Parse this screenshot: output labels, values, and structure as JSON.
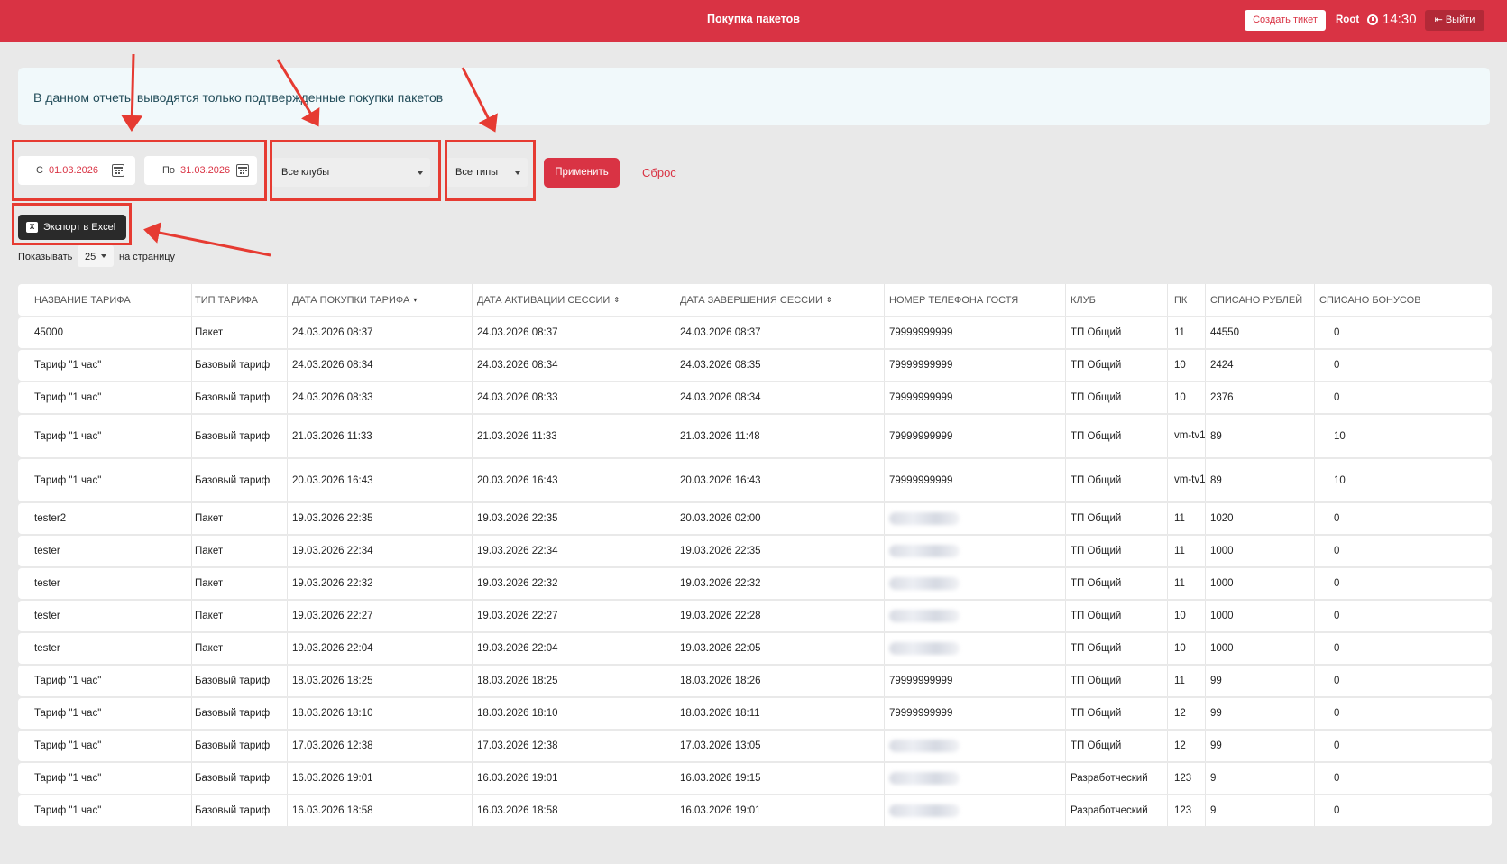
{
  "header": {
    "title": "Покупка пакетов",
    "create_ticket": "Создать тикет",
    "user": "Root",
    "time": "14:30",
    "logout": "Выйти"
  },
  "notice": "В данном отчеты выводятся только подтвержденные покупки пакетов",
  "filters": {
    "date_from_label": "С",
    "date_from": "01.03.2026",
    "date_to_label": "По",
    "date_to": "31.03.2026",
    "club_select": "Все клубы",
    "type_select": "Все типы",
    "apply": "Применить",
    "reset": "Сброс"
  },
  "export_button": "Экспорт в Excel",
  "pagination": {
    "show_label": "Показывать",
    "per_page": "25",
    "per_page_suffix": "на страницу"
  },
  "table": {
    "headers": [
      "НАЗВАНИЕ ТАРИФА",
      "ТИП ТАРИФА",
      "ДАТА ПОКУПКИ ТАРИФА",
      "ДАТА АКТИВАЦИИ СЕССИИ",
      "ДАТА ЗАВЕРШЕНИЯ СЕССИИ",
      "НОМЕР ТЕЛЕФОНА ГОСТЯ",
      "КЛУБ",
      "ПК",
      "СПИСАНО РУБЛЕЙ",
      "СПИСАНО БОНУСОВ"
    ],
    "rows": [
      [
        "45000",
        "Пакет",
        "24.03.2026 08:37",
        "24.03.2026 08:37",
        "24.03.2026 08:37",
        "79999999999",
        "ТП Общий",
        "11",
        "44550",
        "0"
      ],
      [
        "Тариф \"1 час\"",
        "Базовый тариф",
        "24.03.2026 08:34",
        "24.03.2026 08:34",
        "24.03.2026 08:35",
        "79999999999",
        "ТП Общий",
        "10",
        "2424",
        "0"
      ],
      [
        "Тариф \"1 час\"",
        "Базовый тариф",
        "24.03.2026 08:33",
        "24.03.2026 08:33",
        "24.03.2026 08:34",
        "79999999999",
        "ТП Общий",
        "10",
        "2376",
        "0"
      ],
      [
        "Тариф \"1 час\"",
        "Базовый тариф",
        "21.03.2026 11:33",
        "21.03.2026 11:33",
        "21.03.2026 11:48",
        "79999999999",
        "ТП Общий",
        "vm-tv1",
        "89",
        "10"
      ],
      [
        "Тариф \"1 час\"",
        "Базовый тариф",
        "20.03.2026 16:43",
        "20.03.2026 16:43",
        "20.03.2026 16:43",
        "79999999999",
        "ТП Общий",
        "vm-tv1",
        "89",
        "10"
      ],
      [
        "tester2",
        "Пакет",
        "19.03.2026 22:35",
        "19.03.2026 22:35",
        "20.03.2026 02:00",
        "",
        "ТП Общий",
        "11",
        "1020",
        "0"
      ],
      [
        "tester",
        "Пакет",
        "19.03.2026 22:34",
        "19.03.2026 22:34",
        "19.03.2026 22:35",
        "",
        "ТП Общий",
        "11",
        "1000",
        "0"
      ],
      [
        "tester",
        "Пакет",
        "19.03.2026 22:32",
        "19.03.2026 22:32",
        "19.03.2026 22:32",
        "",
        "ТП Общий",
        "11",
        "1000",
        "0"
      ],
      [
        "tester",
        "Пакет",
        "19.03.2026 22:27",
        "19.03.2026 22:27",
        "19.03.2026 22:28",
        "",
        "ТП Общий",
        "10",
        "1000",
        "0"
      ],
      [
        "tester",
        "Пакет",
        "19.03.2026 22:04",
        "19.03.2026 22:04",
        "19.03.2026 22:05",
        "",
        "ТП Общий",
        "10",
        "1000",
        "0"
      ],
      [
        "Тариф \"1 час\"",
        "Базовый тариф",
        "18.03.2026 18:25",
        "18.03.2026 18:25",
        "18.03.2026 18:26",
        "79999999999",
        "ТП Общий",
        "11",
        "99",
        "0"
      ],
      [
        "Тариф \"1 час\"",
        "Базовый тариф",
        "18.03.2026 18:10",
        "18.03.2026 18:10",
        "18.03.2026 18:11",
        "79999999999",
        "ТП Общий",
        "12",
        "99",
        "0"
      ],
      [
        "Тариф \"1 час\"",
        "Базовый тариф",
        "17.03.2026 12:38",
        "17.03.2026 12:38",
        "17.03.2026 13:05",
        "",
        "ТП Общий",
        "12",
        "99",
        "0"
      ],
      [
        "Тариф \"1 час\"",
        "Базовый тариф",
        "16.03.2026 19:01",
        "16.03.2026 19:01",
        "16.03.2026 19:15",
        "",
        "Разработческий",
        "123",
        "9",
        "0"
      ],
      [
        "Тариф \"1 час\"",
        "Базовый тариф",
        "16.03.2026 18:58",
        "16.03.2026 18:58",
        "16.03.2026 19:01",
        "",
        "Разработческий",
        "123",
        "9",
        "0"
      ]
    ]
  },
  "colors": {
    "brand": "#d93344",
    "annotation": "#e63b32"
  }
}
